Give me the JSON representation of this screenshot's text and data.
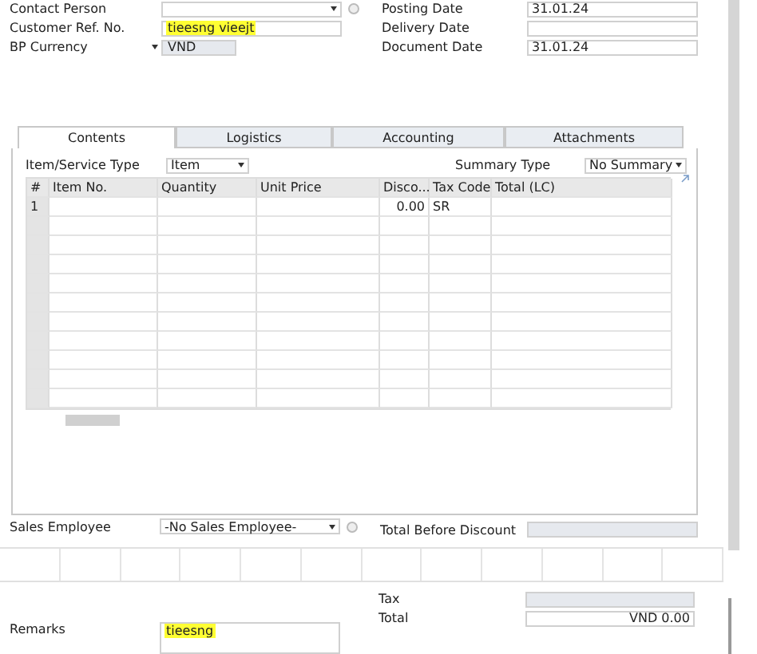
{
  "header_left": [
    {
      "label": "Contact Person",
      "kind": "dropdown"
    },
    {
      "label": "Customer Ref. No.",
      "value": "tieesng vieejt",
      "kind": "text",
      "highlighted": true
    },
    {
      "label": "BP Currency",
      "value": "VND",
      "kind": "currency",
      "highlighted": false
    }
  ],
  "header_right": [
    {
      "label": "Posting Date",
      "value": "31.01.24"
    },
    {
      "label": "Delivery Date"
    },
    {
      "label": "Document Date",
      "value": "31.01.24"
    }
  ],
  "tabs": [
    {
      "label": "Contents",
      "selected": true
    },
    {
      "label": "Logistics",
      "selected": false
    },
    {
      "label": "Accounting",
      "selected": false
    },
    {
      "label": "Attachments",
      "selected": false
    }
  ],
  "item_service_type": {
    "label": "Item/Service Type",
    "value": "Item"
  },
  "summary_type": {
    "label": "Summary Type",
    "value": "No Summary"
  },
  "table": {
    "columns": [
      "#",
      "Item No.",
      "Quantity",
      "Unit Price",
      "Disco...",
      "Tax Code",
      "Total (LC)"
    ],
    "rows": [
      [
        "1",
        null,
        null,
        null,
        "0.00",
        "SR",
        null
      ]
    ]
  },
  "sales_employee": {
    "label": "Sales Employee",
    "value": "-No Sales Employee-"
  },
  "total_before_discount": {
    "label": "Total Before Discount"
  },
  "tax": {
    "label": "Tax"
  },
  "total": {
    "label": "Total",
    "value": "VND 0.00"
  },
  "remarks": {
    "label": "Remarks",
    "value": "tieesng",
    "highlighted": true
  }
}
